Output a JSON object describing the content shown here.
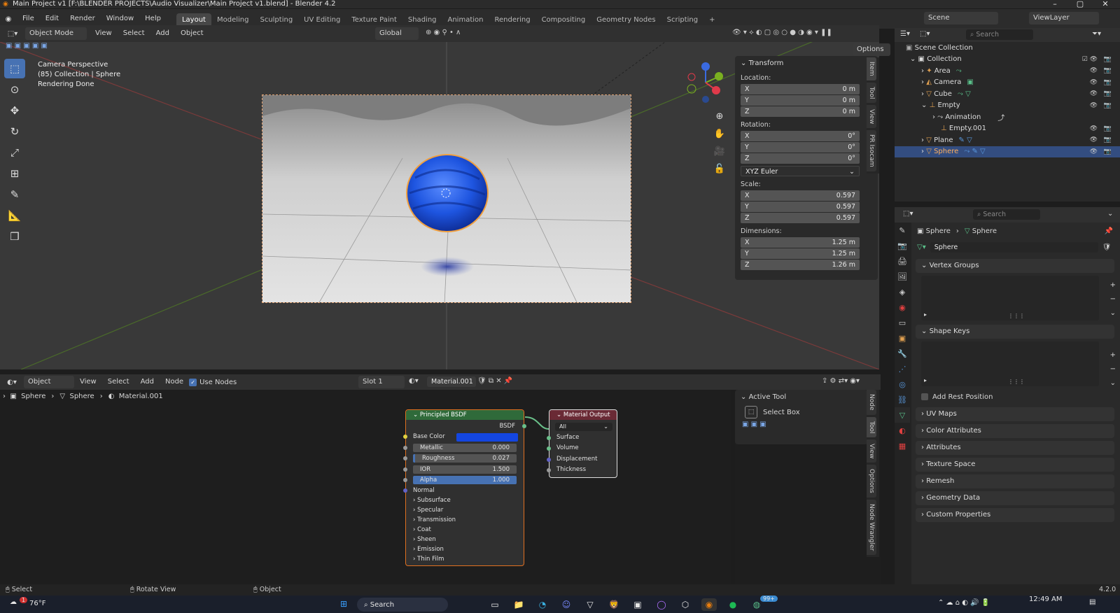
{
  "titlebar": {
    "title": "Main Project v1 [F:\\BLENDER PROJECTS\\Audio Visualizer\\Main Project v1.blend] - Blender 4.2"
  },
  "menu": [
    "File",
    "Edit",
    "Render",
    "Window",
    "Help"
  ],
  "workspaces": [
    "Layout",
    "Modeling",
    "Sculpting",
    "UV Editing",
    "Texture Paint",
    "Shading",
    "Animation",
    "Rendering",
    "Compositing",
    "Geometry Nodes",
    "Scripting"
  ],
  "scene": {
    "scene_label": "Scene",
    "viewlayer_label": "ViewLayer"
  },
  "viewport_header": {
    "mode": "Object Mode",
    "view": "View",
    "select": "Select",
    "add": "Add",
    "object": "Object",
    "orientation": "Global",
    "options": "Options"
  },
  "viewport_info": {
    "line1": "Camera Perspective",
    "line2": "(85) Collection | Sphere",
    "line3": "Rendering Done"
  },
  "npanel": {
    "title": "Transform",
    "location_label": "Location:",
    "location": [
      {
        "axis": "X",
        "val": "0 m"
      },
      {
        "axis": "Y",
        "val": "0 m"
      },
      {
        "axis": "Z",
        "val": "0 m"
      }
    ],
    "rotation_label": "Rotation:",
    "rotation": [
      {
        "axis": "X",
        "val": "0°"
      },
      {
        "axis": "Y",
        "val": "0°"
      },
      {
        "axis": "Z",
        "val": "0°"
      }
    ],
    "rotation_mode": "XYZ Euler",
    "scale_label": "Scale:",
    "scale": [
      {
        "axis": "X",
        "val": "0.597"
      },
      {
        "axis": "Y",
        "val": "0.597"
      },
      {
        "axis": "Z",
        "val": "0.597"
      }
    ],
    "dimensions_label": "Dimensions:",
    "dimensions": [
      {
        "axis": "X",
        "val": "1.25 m"
      },
      {
        "axis": "Y",
        "val": "1.25 m"
      },
      {
        "axis": "Z",
        "val": "1.26 m"
      }
    ],
    "tabs": [
      "Item",
      "Tool",
      "View",
      "PR Isocam"
    ]
  },
  "outliner": {
    "search_placeholder": "Search",
    "scene_collection": "Scene Collection",
    "rows": [
      "Collection",
      "Area",
      "Camera",
      "Cube",
      "Empty",
      "Animation",
      "Empty.001",
      "Plane",
      "Sphere"
    ]
  },
  "properties": {
    "search_placeholder": "Search",
    "breadcrumb": [
      "Sphere",
      "Sphere"
    ],
    "mesh_name": "Sphere",
    "vertex_groups": "Vertex Groups",
    "shape_keys": "Shape Keys",
    "add_rest_position": "Add Rest Position",
    "sections": [
      "UV Maps",
      "Color Attributes",
      "Attributes",
      "Texture Space",
      "Remesh",
      "Geometry Data",
      "Custom Properties"
    ]
  },
  "node_header": {
    "editor": "Object",
    "view": "View",
    "select": "Select",
    "add": "Add",
    "node": "Node",
    "use_nodes": "Use Nodes",
    "slot": "Slot 1",
    "material": "Material.001"
  },
  "node_breadcrumb": [
    "Sphere",
    "Sphere",
    "Material.001"
  ],
  "bsdf": {
    "title": "Principled BSDF",
    "output": "BSDF",
    "base_color": "Base Color",
    "base_color_hex": "#1446e0",
    "metallic_label": "Metallic",
    "metallic": "0.000",
    "roughness_label": "Roughness",
    "roughness": "0.027",
    "ior_label": "IOR",
    "ior": "1.500",
    "alpha_label": "Alpha",
    "alpha": "1.000",
    "normal": "Normal",
    "panels": [
      "Subsurface",
      "Specular",
      "Transmission",
      "Coat",
      "Sheen",
      "Emission",
      "Thin Film"
    ]
  },
  "matout": {
    "title": "Material Output",
    "target": "All",
    "sockets": [
      "Surface",
      "Volume",
      "Displacement",
      "Thickness"
    ]
  },
  "active_tool": {
    "title": "Active Tool",
    "tool": "Select Box"
  },
  "node_side_tabs": [
    "Node",
    "Tool",
    "View",
    "Options",
    "Node Wrangler"
  ],
  "statusbar": {
    "select": "Select",
    "rotate": "Rotate View",
    "object": "Object",
    "version": "4.2.0"
  },
  "taskbar": {
    "temp": "76°F",
    "search": "Search",
    "time": "12:49 AM",
    "badge1": "1",
    "badge2": "99+"
  }
}
